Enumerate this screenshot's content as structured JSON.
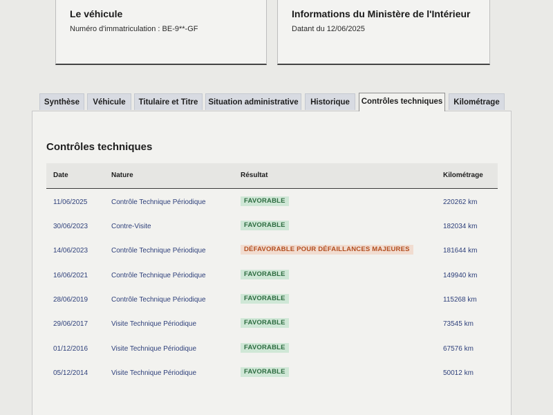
{
  "vehicle_card": {
    "title": "Le véhicule",
    "registration": "Numéro d'immatriculation : BE-9**-GF"
  },
  "info_card": {
    "title": "Informations du Ministère de l'Intérieur",
    "date_line": "Datant du 12/06/2025"
  },
  "tabs": [
    {
      "label": "Synthèse",
      "active": false
    },
    {
      "label": "Véhicule",
      "active": false
    },
    {
      "label": "Titulaire et Titre",
      "active": false
    },
    {
      "label": "Situation administrative",
      "active": false
    },
    {
      "label": "Historique",
      "active": false
    },
    {
      "label": "Contrôles techniques",
      "active": true
    },
    {
      "label": "Kilométrage",
      "active": false
    }
  ],
  "section_title": "Contrôles techniques",
  "table": {
    "headers": [
      "Date",
      "Nature",
      "Résultat",
      "Kilométrage"
    ],
    "rows": [
      {
        "date": "11/06/2025",
        "nature": "Contrôle Technique Périodique",
        "result": "FAVORABLE",
        "status": "favorable",
        "km": "220262 km"
      },
      {
        "date": "30/06/2023",
        "nature": "Contre-Visite",
        "result": "FAVORABLE",
        "status": "favorable",
        "km": "182034 km"
      },
      {
        "date": "14/06/2023",
        "nature": "Contrôle Technique Périodique",
        "result": "DÉFAVORABLE POUR DÉFAILLANCES MAJEURES",
        "status": "defavorable",
        "km": "181644 km"
      },
      {
        "date": "16/06/2021",
        "nature": "Contrôle Technique Périodique",
        "result": "FAVORABLE",
        "status": "favorable",
        "km": "149940 km"
      },
      {
        "date": "28/06/2019",
        "nature": "Contrôle Technique Périodique",
        "result": "FAVORABLE",
        "status": "favorable",
        "km": "115268 km"
      },
      {
        "date": "29/06/2017",
        "nature": "Visite Technique Périodique",
        "result": "FAVORABLE",
        "status": "favorable",
        "km": "73545 km"
      },
      {
        "date": "01/12/2016",
        "nature": "Visite Technique Périodique",
        "result": "FAVORABLE",
        "status": "favorable",
        "km": "67576 km"
      },
      {
        "date": "05/12/2014",
        "nature": "Visite Technique Périodique",
        "result": "FAVORABLE",
        "status": "favorable",
        "km": "50012 km"
      }
    ]
  },
  "colors": {
    "favorable_bg": "#cfe7d6",
    "favorable_text": "#2c6b3f",
    "defavorable_bg": "#f1dcd0",
    "defavorable_text": "#b34e1f",
    "link_text": "#2d3f7a"
  }
}
